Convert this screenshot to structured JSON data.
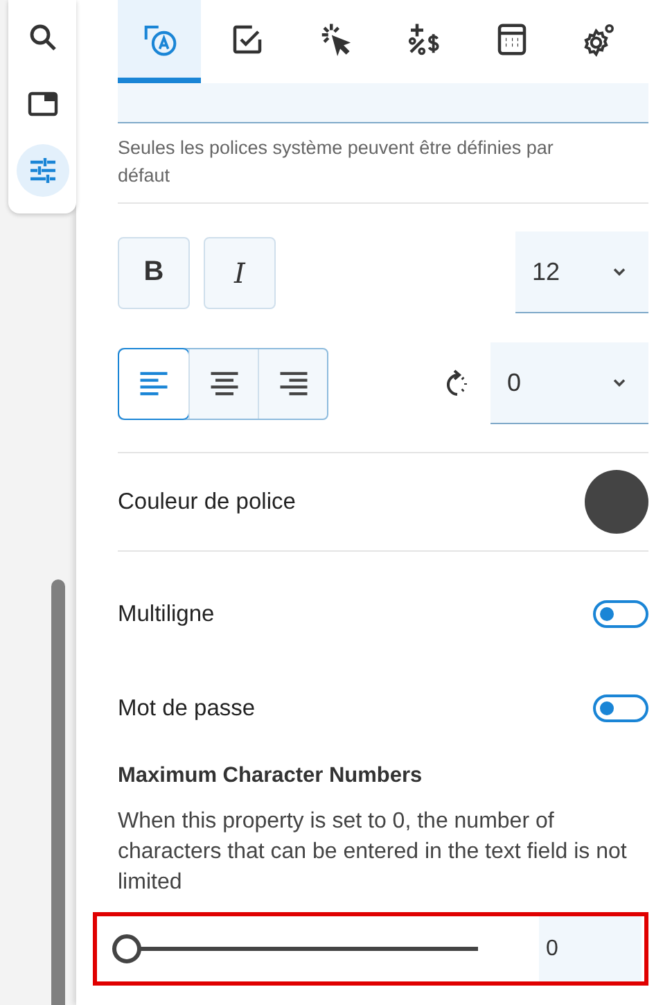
{
  "sidebar": {
    "items": [
      {
        "kind": "search",
        "selected": false
      },
      {
        "kind": "panel",
        "selected": false
      },
      {
        "kind": "sliders",
        "selected": true
      }
    ]
  },
  "tabs": [
    {
      "kind": "text-field",
      "selected": true
    },
    {
      "kind": "checkbox",
      "selected": false
    },
    {
      "kind": "click",
      "selected": false
    },
    {
      "kind": "format",
      "selected": false
    },
    {
      "kind": "calculator",
      "selected": false
    },
    {
      "kind": "gear",
      "selected": false
    }
  ],
  "font_hint": "Seules les polices système peuvent être définies par défaut",
  "style_buttons": [
    {
      "label": "B",
      "kind": "bold",
      "selected": false
    },
    {
      "label": "I",
      "kind": "italic",
      "selected": false
    }
  ],
  "font_size": {
    "value": "12"
  },
  "alignment": [
    {
      "kind": "left",
      "selected": true
    },
    {
      "kind": "center",
      "selected": false
    },
    {
      "kind": "right",
      "selected": false
    }
  ],
  "rotation": {
    "value": "0"
  },
  "font_color": {
    "label": "Couleur de police",
    "color": "#444444"
  },
  "toggles": [
    {
      "label": "Multiligne",
      "on": false
    },
    {
      "label": "Mot de passe",
      "on": false
    }
  ],
  "max_chars": {
    "title": "Maximum Character Numbers",
    "description": "When this property is set to 0, the number of characters that can be entered in the text field is not limited",
    "level": 0,
    "value": "0",
    "highlighted": true
  }
}
